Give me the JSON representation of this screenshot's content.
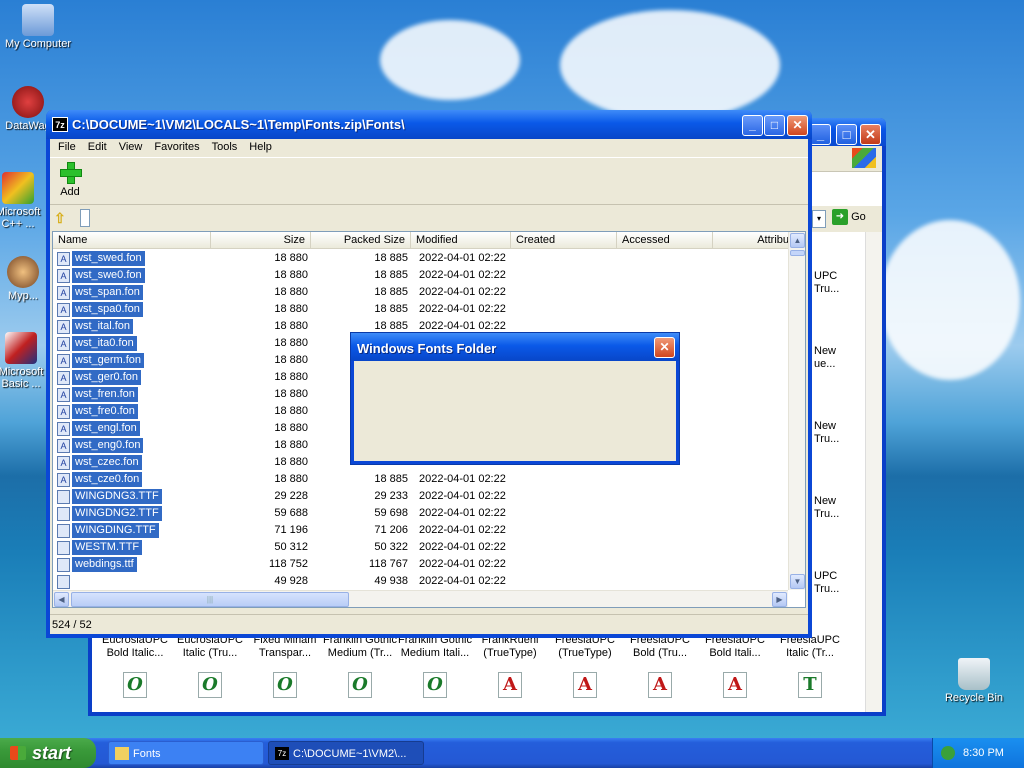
{
  "desktop": {
    "icons": [
      {
        "label": "My Computer"
      },
      {
        "label": "DataWag"
      },
      {
        "label": "Microsoft C++ ..."
      },
      {
        "label": "Myp..."
      },
      {
        "label": "Microsoft Basic ..."
      },
      {
        "label": "Recycle Bin"
      }
    ]
  },
  "back_window": {
    "go_label": "Go",
    "fonts": [
      {
        "line1": "EucrosiaUPC",
        "line2": "Bold Italic...",
        "icon": "O"
      },
      {
        "line1": "EucrosiaUPC",
        "line2": "Italic (Tru...",
        "icon": "O"
      },
      {
        "line1": "Fixed Miriam",
        "line2": "Transpar...",
        "icon": "O"
      },
      {
        "line1": "Franklin Gothic",
        "line2": "Medium (Tr...",
        "icon": "O"
      },
      {
        "line1": "Franklin Gothic",
        "line2": "Medium Itali...",
        "icon": "O"
      },
      {
        "line1": "FrankRuehl",
        "line2": "(TrueType)",
        "icon": "A"
      },
      {
        "line1": "FreesiaUPC",
        "line2": "(TrueType)",
        "icon": "A"
      },
      {
        "line1": "FreesiaUPC",
        "line2": "Bold (Tru...",
        "icon": "A"
      },
      {
        "line1": "FreesiaUPC",
        "line2": "Bold Itali...",
        "icon": "A"
      },
      {
        "line1": "FreesiaUPC",
        "line2": "Italic (Tr...",
        "icon": "T"
      }
    ],
    "side_labels": [
      {
        "l1": "UPC",
        "l2": "Tru..."
      },
      {
        "l1": "New",
        "l2": "ue..."
      },
      {
        "l1": "New",
        "l2": "Tru..."
      },
      {
        "l1": "New",
        "l2": "Tru..."
      },
      {
        "l1": "UPC",
        "l2": "Tru..."
      }
    ]
  },
  "main_window": {
    "title": "C:\\DOCUME~1\\VM2\\LOCALS~1\\Temp\\Fonts.zip\\Fonts\\",
    "app_icon_text": "7z",
    "menu": [
      "File",
      "Edit",
      "View",
      "Favorites",
      "Tools",
      "Help"
    ],
    "toolbar": {
      "add_label": "Add"
    },
    "columns": [
      "Name",
      "Size",
      "Packed Size",
      "Modified",
      "Created",
      "Accessed",
      "Attribu"
    ],
    "rows": [
      {
        "name": "wst_swed.fon",
        "size": "18 880",
        "packed": "18 885",
        "modified": "2022-04-01 02:22",
        "type": "fon"
      },
      {
        "name": "wst_swe0.fon",
        "size": "18 880",
        "packed": "18 885",
        "modified": "2022-04-01 02:22",
        "type": "fon"
      },
      {
        "name": "wst_span.fon",
        "size": "18 880",
        "packed": "18 885",
        "modified": "2022-04-01 02:22",
        "type": "fon"
      },
      {
        "name": "wst_spa0.fon",
        "size": "18 880",
        "packed": "18 885",
        "modified": "2022-04-01 02:22",
        "type": "fon"
      },
      {
        "name": "wst_ital.fon",
        "size": "18 880",
        "packed": "18 885",
        "modified": "2022-04-01 02:22",
        "type": "fon"
      },
      {
        "name": "wst_ita0.fon",
        "size": "18 880",
        "packed": "",
        "modified": "",
        "type": "fon"
      },
      {
        "name": "wst_germ.fon",
        "size": "18 880",
        "packed": "",
        "modified": "",
        "type": "fon"
      },
      {
        "name": "wst_ger0.fon",
        "size": "18 880",
        "packed": "",
        "modified": "",
        "type": "fon"
      },
      {
        "name": "wst_fren.fon",
        "size": "18 880",
        "packed": "",
        "modified": "",
        "type": "fon"
      },
      {
        "name": "wst_fre0.fon",
        "size": "18 880",
        "packed": "",
        "modified": "",
        "type": "fon"
      },
      {
        "name": "wst_engl.fon",
        "size": "18 880",
        "packed": "",
        "modified": "",
        "type": "fon"
      },
      {
        "name": "wst_eng0.fon",
        "size": "18 880",
        "packed": "",
        "modified": "",
        "type": "fon"
      },
      {
        "name": "wst_czec.fon",
        "size": "18 880",
        "packed": "18 885",
        "modified": "2022-04-01 02:22",
        "type": "fon"
      },
      {
        "name": "wst_cze0.fon",
        "size": "18 880",
        "packed": "18 885",
        "modified": "2022-04-01 02:22",
        "type": "fon"
      },
      {
        "name": "WINGDNG3.TTF",
        "size": "29 228",
        "packed": "29 233",
        "modified": "2022-04-01 02:22",
        "type": "ttf"
      },
      {
        "name": "WINGDNG2.TTF",
        "size": "59 688",
        "packed": "59 698",
        "modified": "2022-04-01 02:22",
        "type": "ttf"
      },
      {
        "name": "WINGDING.TTF",
        "size": "71 196",
        "packed": "71 206",
        "modified": "2022-04-01 02:22",
        "type": "ttf"
      },
      {
        "name": "WESTM.TTF",
        "size": "50 312",
        "packed": "50 322",
        "modified": "2022-04-01 02:22",
        "type": "ttf"
      },
      {
        "name": "webdings.ttf",
        "size": "118 752",
        "packed": "118 767",
        "modified": "2022-04-01 02:22",
        "type": "ttf"
      },
      {
        "name": "",
        "size": "49 928",
        "packed": "49 938",
        "modified": "2022-04-01 02:22",
        "type": "ttf"
      }
    ],
    "status": "524 / 52"
  },
  "dialog": {
    "title": "Windows Fonts Folder"
  },
  "taskbar": {
    "start_label": "start",
    "tasks": [
      {
        "label": "Fonts"
      },
      {
        "label": "C:\\DOCUME~1\\VM2\\..."
      }
    ],
    "clock": "8:30 PM"
  },
  "colors": {
    "selection": "#316ac5",
    "titlebar": "#0a59e8",
    "start_green": "#3a9a3a",
    "desktop_sky": "#2a7fd4"
  }
}
